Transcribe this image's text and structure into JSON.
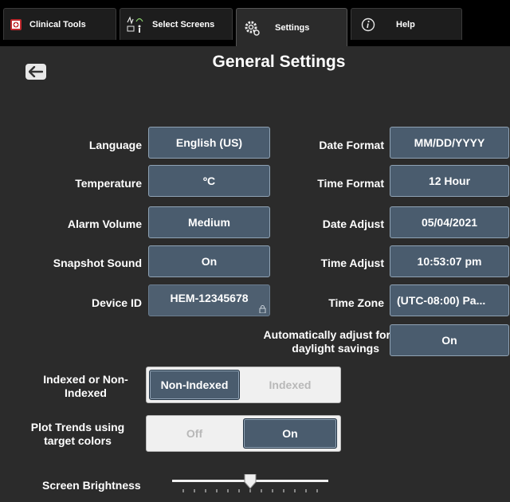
{
  "tabs": [
    {
      "label": "Clinical Tools",
      "icon": "first-aid-icon"
    },
    {
      "label": "Select Screens",
      "icon": "screens-icon"
    },
    {
      "label": "Settings",
      "icon": "gear-icon"
    },
    {
      "label": "Help",
      "icon": "info-icon"
    }
  ],
  "page": {
    "title": "General Settings"
  },
  "left": {
    "language": {
      "label": "Language",
      "value": "English (US)"
    },
    "temperature": {
      "label": "Temperature",
      "value": "ºC"
    },
    "alarm_volume": {
      "label": "Alarm Volume",
      "value": "Medium"
    },
    "snapshot_sound": {
      "label": "Snapshot Sound",
      "value": "On"
    },
    "device_id": {
      "label": "Device ID",
      "value": "HEM-12345678"
    }
  },
  "right": {
    "date_format": {
      "label": "Date Format",
      "value": "MM/DD/YYYY"
    },
    "time_format": {
      "label": "Time Format",
      "value": "12 Hour"
    },
    "date_adjust": {
      "label": "Date Adjust",
      "value": "05/04/2021"
    },
    "time_adjust": {
      "label": "Time Adjust",
      "value": "10:53:07 pm"
    },
    "time_zone": {
      "label": "Time Zone",
      "value": "(UTC-08:00) Pa..."
    },
    "dst": {
      "label_line1": "Automatically adjust for",
      "label_line2": "daylight savings",
      "value": "On"
    }
  },
  "indexed": {
    "label_line1": "Indexed or Non-",
    "label_line2": "Indexed",
    "options": [
      "Non-Indexed",
      "Indexed"
    ],
    "selected": "Non-Indexed"
  },
  "plot_trends": {
    "label_line1": "Plot Trends using",
    "label_line2": "target colors",
    "options": [
      "Off",
      "On"
    ],
    "selected": "On"
  },
  "brightness": {
    "label": "Screen Brightness",
    "level": 0.5
  },
  "colors": {
    "button_fill": "#4a5c6e",
    "button_border": "#8fa2b4",
    "background": "#2b2b2b",
    "topbar": "#000000"
  }
}
